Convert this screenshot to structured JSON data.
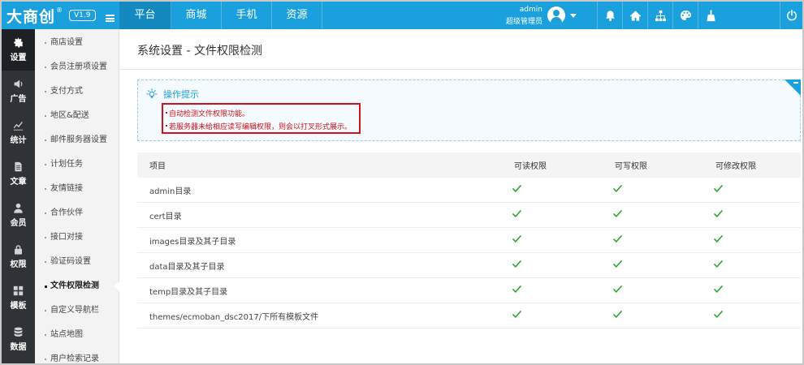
{
  "brand": {
    "name": "大商创",
    "reg": "®",
    "version": "V1.9"
  },
  "topnav": [
    {
      "label": "平台",
      "active": true
    },
    {
      "label": "商城",
      "active": false
    },
    {
      "label": "手机",
      "active": false
    },
    {
      "label": "资源",
      "active": false
    }
  ],
  "user": {
    "name": "admin",
    "role": "超级管理员"
  },
  "tools": [
    "bell-icon",
    "home-icon",
    "sitemap-icon",
    "palette-icon",
    "broom-icon",
    "power-icon"
  ],
  "rail": [
    {
      "label": "设置",
      "icon": "gear-icon",
      "active": true
    },
    {
      "label": "广告",
      "icon": "speaker-icon",
      "active": false
    },
    {
      "label": "统计",
      "icon": "chart-icon",
      "active": false
    },
    {
      "label": "文章",
      "icon": "document-icon",
      "active": false
    },
    {
      "label": "会员",
      "icon": "user-icon",
      "active": false
    },
    {
      "label": "权限",
      "icon": "lock-icon",
      "active": false
    },
    {
      "label": "模板",
      "icon": "grid-icon",
      "active": false
    },
    {
      "label": "数据",
      "icon": "database-icon",
      "active": false
    }
  ],
  "submenu": [
    "商店设置",
    "会员注册项设置",
    "支付方式",
    "地区&配送",
    "邮件服务器设置",
    "计划任务",
    "友情链接",
    "合作伙伴",
    "接口对接",
    "验证码设置",
    "文件权限检测",
    "自定义导航栏",
    "站点地图",
    "用户检索记录"
  ],
  "submenu_active_index": 10,
  "page": {
    "title": "系统设置 - 文件权限检测",
    "tips_title": "操作提示",
    "tips": [
      "自动检测文件权限功能。",
      "若服务器未给相应读写编辑权限，则会以打叉形式展示。"
    ]
  },
  "table": {
    "headers": {
      "name": "项目",
      "read": "可读权限",
      "write": "可写权限",
      "modify": "可修改权限"
    },
    "rows": [
      {
        "name": "admin目录",
        "read": true,
        "write": true,
        "modify": true
      },
      {
        "name": "cert目录",
        "read": true,
        "write": true,
        "modify": true
      },
      {
        "name": "images目录及其子目录",
        "read": true,
        "write": true,
        "modify": true
      },
      {
        "name": "data目录及其子目录",
        "read": true,
        "write": true,
        "modify": true
      },
      {
        "name": "temp目录及其子目录",
        "read": true,
        "write": true,
        "modify": true
      },
      {
        "name": "themes/ecmoban_dsc2017/下所有模板文件",
        "read": true,
        "write": true,
        "modify": true
      }
    ]
  },
  "colors": {
    "topbar": "#1aa0dc",
    "rail": "#2f3338",
    "check": "#2aa52a",
    "highlight": "#d0121b"
  }
}
